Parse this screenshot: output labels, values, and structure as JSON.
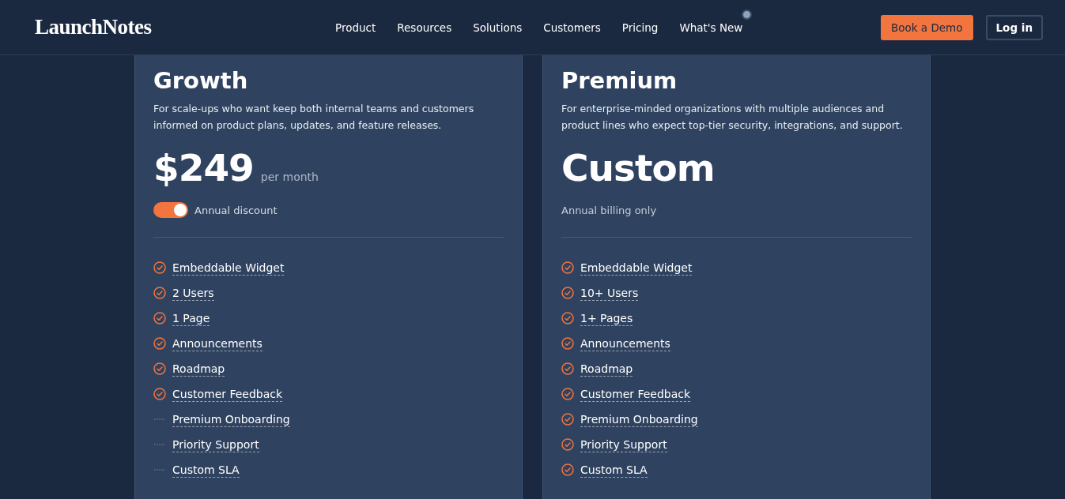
{
  "header": {
    "logo": "LaunchNotes",
    "nav": [
      {
        "label": "Product",
        "new_dot": false
      },
      {
        "label": "Resources",
        "new_dot": false
      },
      {
        "label": "Solutions",
        "new_dot": false
      },
      {
        "label": "Customers",
        "new_dot": false
      },
      {
        "label": "Pricing",
        "new_dot": false
      },
      {
        "label": "What's New",
        "new_dot": true
      }
    ],
    "demo_button": "Book a Demo",
    "login_button": "Log in"
  },
  "plans": [
    {
      "name": "Growth",
      "description": "For scale-ups who want keep both internal teams and customers informed on product plans, updates, and feature releases.",
      "price": "$249",
      "period": "per month",
      "toggle": {
        "label": "Annual discount",
        "on": true
      },
      "features": [
        {
          "label": "Embeddable Widget",
          "included": true
        },
        {
          "label": "2 Users",
          "included": true
        },
        {
          "label": "1 Page",
          "included": true
        },
        {
          "label": "Announcements",
          "included": true
        },
        {
          "label": "Roadmap",
          "included": true
        },
        {
          "label": "Customer Feedback",
          "included": true
        },
        {
          "label": "Premium Onboarding",
          "included": false
        },
        {
          "label": "Priority Support",
          "included": false
        },
        {
          "label": "Custom SLA",
          "included": false
        }
      ]
    },
    {
      "name": "Premium",
      "description": "For enterprise-minded organizations with multiple audiences and product lines who expect top-tier security, integrations, and support.",
      "price": "Custom",
      "note": "Annual billing only",
      "features": [
        {
          "label": "Embeddable Widget",
          "included": true
        },
        {
          "label": "10+ Users",
          "included": true
        },
        {
          "label": "1+ Pages",
          "included": true
        },
        {
          "label": "Announcements",
          "included": true
        },
        {
          "label": "Roadmap",
          "included": true
        },
        {
          "label": "Customer Feedback",
          "included": true
        },
        {
          "label": "Premium Onboarding",
          "included": true
        },
        {
          "label": "Priority Support",
          "included": true
        },
        {
          "label": "Custom SLA",
          "included": true
        }
      ]
    }
  ]
}
